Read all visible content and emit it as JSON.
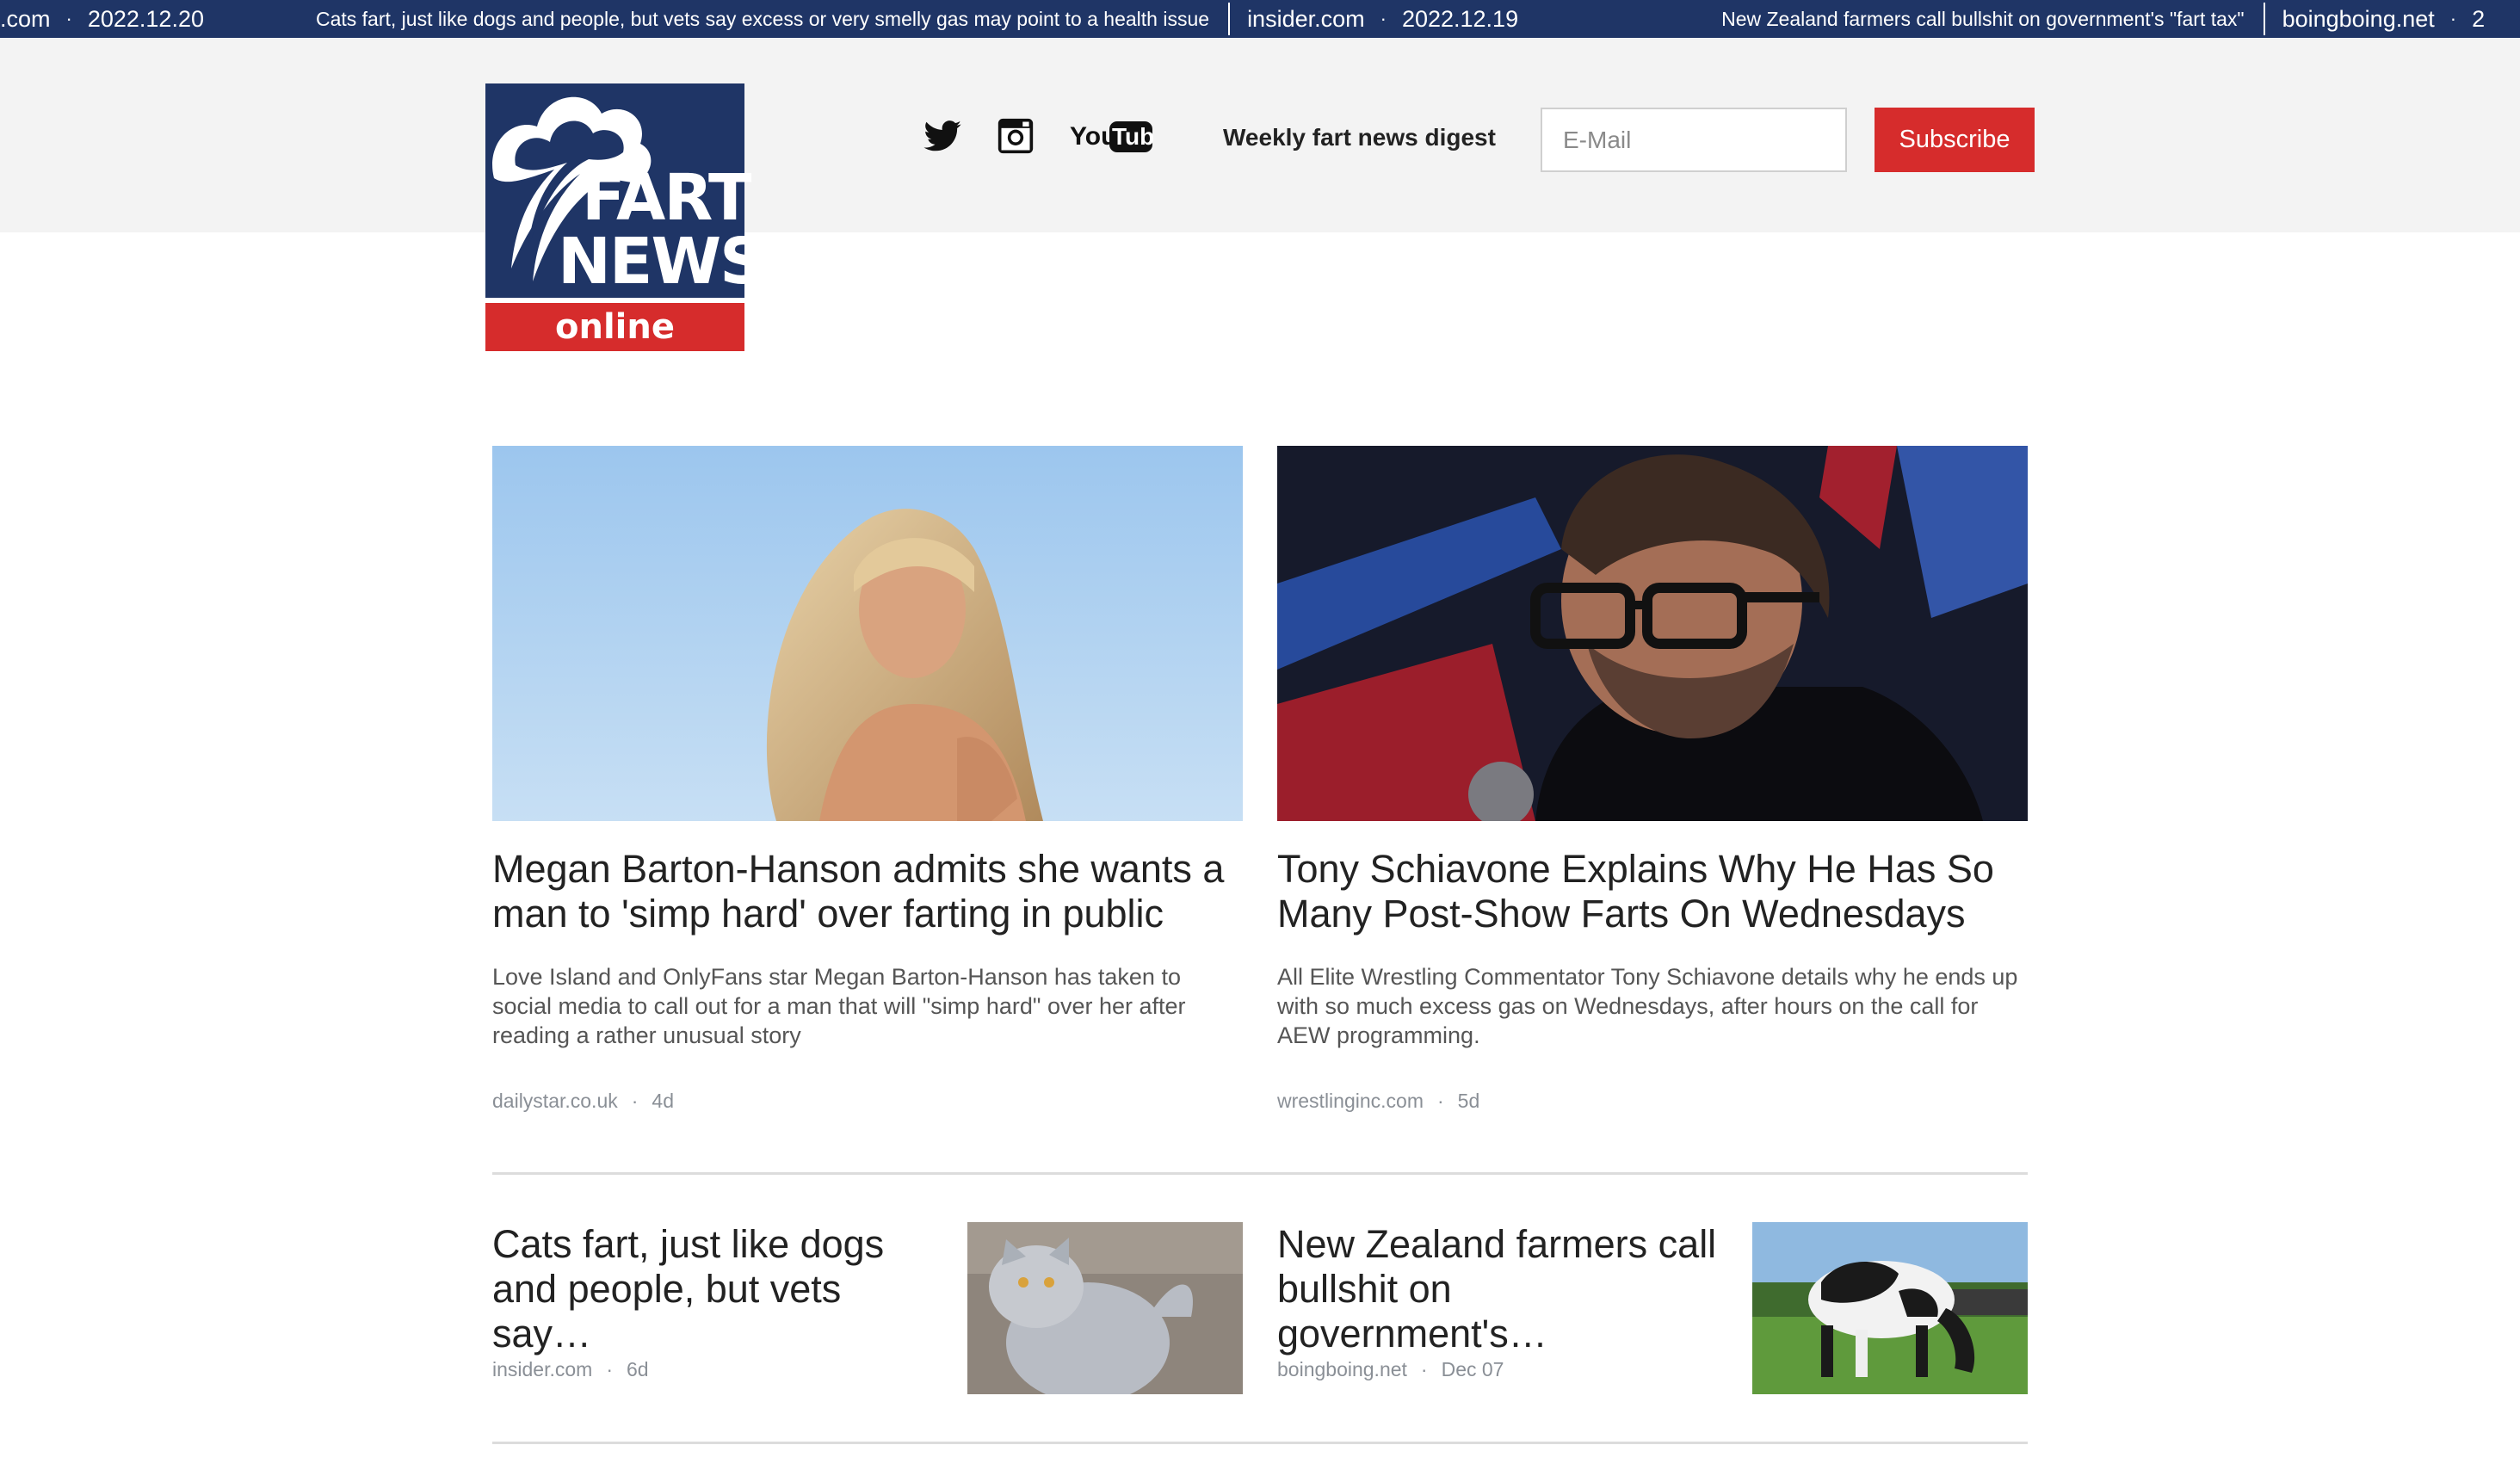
{
  "ticker": [
    {
      "site": ".com",
      "date": "2022.12.20",
      "headline": "Cats fart, just like dogs and people, but vets say excess or very smelly gas may point to a health issue"
    },
    {
      "site": "insider.com",
      "date": "2022.12.19",
      "headline": "New Zealand farmers call bullshit on government's \"fart tax\""
    },
    {
      "site": "boingboing.net",
      "date": "2"
    }
  ],
  "logo": {
    "line1": "FART",
    "line2": "NEWS",
    "line3": "online"
  },
  "social": {
    "twitter_icon": "twitter-icon",
    "instagram_icon": "instagram-icon",
    "youtube_icon": "youtube-icon",
    "youtube_text_1": "You",
    "youtube_text_2": "Tube"
  },
  "newsletter": {
    "label": "Weekly fart news digest",
    "email_placeholder": "E-Mail",
    "email_value": "",
    "subscribe_label": "Subscribe"
  },
  "featured": [
    {
      "title": "Megan Barton-Hanson admits she wants a man to 'simp hard' over farting in public",
      "summary": "Love Island and OnlyFans star Megan Barton-Hanson has taken to social media to call out for a man that will \"simp hard\" over her after reading a rather unusual story",
      "source": "dailystar.co.uk",
      "age": "4d"
    },
    {
      "title": "Tony Schiavone Explains Why He Has So Many Post-Show Farts On Wednesdays",
      "summary": "All Elite Wrestling Commentator Tony Schiavone details why he ends up with so much excess gas on Wednesdays, after hours on the call for AEW programming.",
      "source": "wrestlinginc.com",
      "age": "5d"
    }
  ],
  "more": [
    {
      "title": "Cats fart, just like dogs and people, but vets say…",
      "source": "insider.com",
      "age": "6d"
    },
    {
      "title": "New Zealand farmers call bullshit on government's…",
      "source": "boingboing.net",
      "age": "Dec 07"
    }
  ],
  "colors": {
    "brand_navy": "#1f3566",
    "brand_red": "#d62c2c",
    "header_bg": "#f3f3f3"
  },
  "meta_separator": "·"
}
